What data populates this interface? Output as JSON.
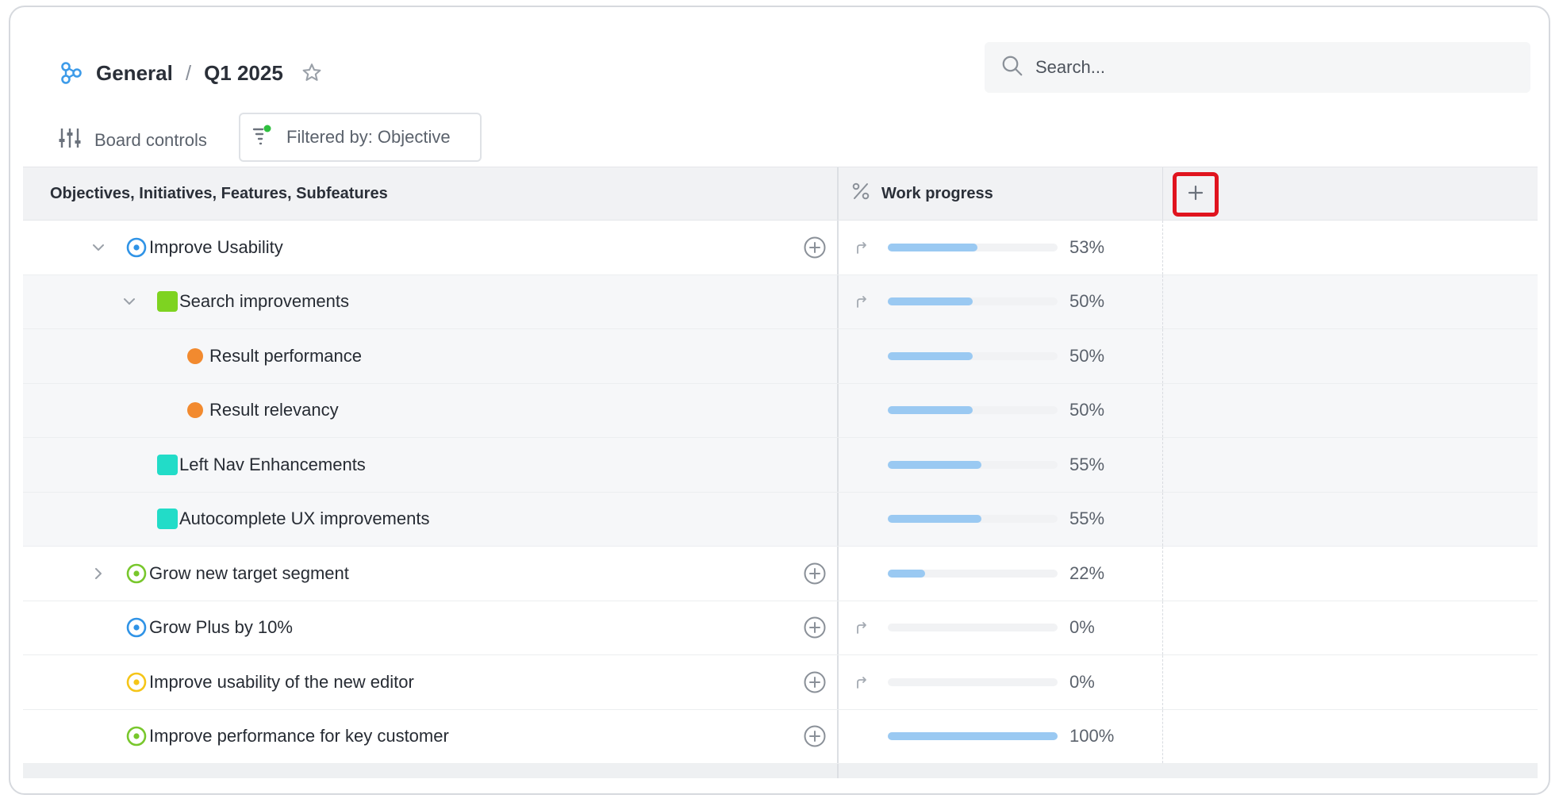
{
  "breadcrumb": {
    "workspace": "General",
    "separator": "/",
    "board": "Q1 2025"
  },
  "search": {
    "placeholder": "Search..."
  },
  "toolbar": {
    "board_controls_label": "Board controls",
    "filter_label": "Filtered by: Objective"
  },
  "table": {
    "name_header": "Objectives, Initiatives, Features, Subfeatures",
    "progress_header": "Work progress",
    "rows": [
      {
        "label": "Improve Usability",
        "type": "objective",
        "color": "#2f93e6",
        "chevron": "down",
        "progress": 53,
        "progress_text": "53%",
        "rollup": true,
        "add": true,
        "shaded": false
      },
      {
        "label": "Search improvements",
        "type": "initiative",
        "color": "#7ed321",
        "chevron": "down",
        "progress": 50,
        "progress_text": "50%",
        "rollup": true,
        "add": false,
        "shaded": true
      },
      {
        "label": "Result performance",
        "type": "feature",
        "color": "#f28a2f",
        "chevron": "",
        "progress": 50,
        "progress_text": "50%",
        "rollup": false,
        "add": false,
        "shaded": true
      },
      {
        "label": "Result relevancy",
        "type": "feature",
        "color": "#f28a2f",
        "chevron": "",
        "progress": 50,
        "progress_text": "50%",
        "rollup": false,
        "add": false,
        "shaded": true
      },
      {
        "label": "Left Nav Enhancements",
        "type": "initiative",
        "color": "#22dcc8",
        "chevron": "",
        "progress": 55,
        "progress_text": "55%",
        "rollup": false,
        "add": false,
        "shaded": true
      },
      {
        "label": "Autocomplete UX improvements",
        "type": "initiative",
        "color": "#22dcc8",
        "chevron": "",
        "progress": 55,
        "progress_text": "55%",
        "rollup": false,
        "add": false,
        "shaded": true
      },
      {
        "label": "Grow new target segment",
        "type": "objective",
        "color": "#78c72c",
        "chevron": "right",
        "progress": 22,
        "progress_text": "22%",
        "rollup": false,
        "add": true,
        "shaded": false
      },
      {
        "label": "Grow Plus by 10%",
        "type": "objective",
        "color": "#2f93e6",
        "chevron": "",
        "progress": 0,
        "progress_text": "0%",
        "rollup": true,
        "add": true,
        "shaded": false
      },
      {
        "label": "Improve usability of the new editor",
        "type": "objective",
        "color": "#f5c518",
        "chevron": "",
        "progress": 0,
        "progress_text": "0%",
        "rollup": true,
        "add": true,
        "shaded": false
      },
      {
        "label": "Improve performance for key customer",
        "type": "objective",
        "color": "#78c72c",
        "chevron": "",
        "progress": 100,
        "progress_text": "100%",
        "rollup": false,
        "add": true,
        "shaded": false
      }
    ]
  },
  "icons": {
    "logo": "hierarchy-icon",
    "favorite": "star-icon",
    "search": "search-icon",
    "board_controls": "sliders-icon",
    "filter": "filter-icon",
    "progress": "percent-icon",
    "add_column": "plus-icon",
    "add_child": "plus-circle-icon",
    "rollup": "rollup-arrow-icon"
  },
  "colors": {
    "accent_blue": "#2f93e6",
    "progress_fill": "#9ac9f2",
    "highlight": "#e0141e",
    "filter_dot": "#2fbf3f"
  }
}
